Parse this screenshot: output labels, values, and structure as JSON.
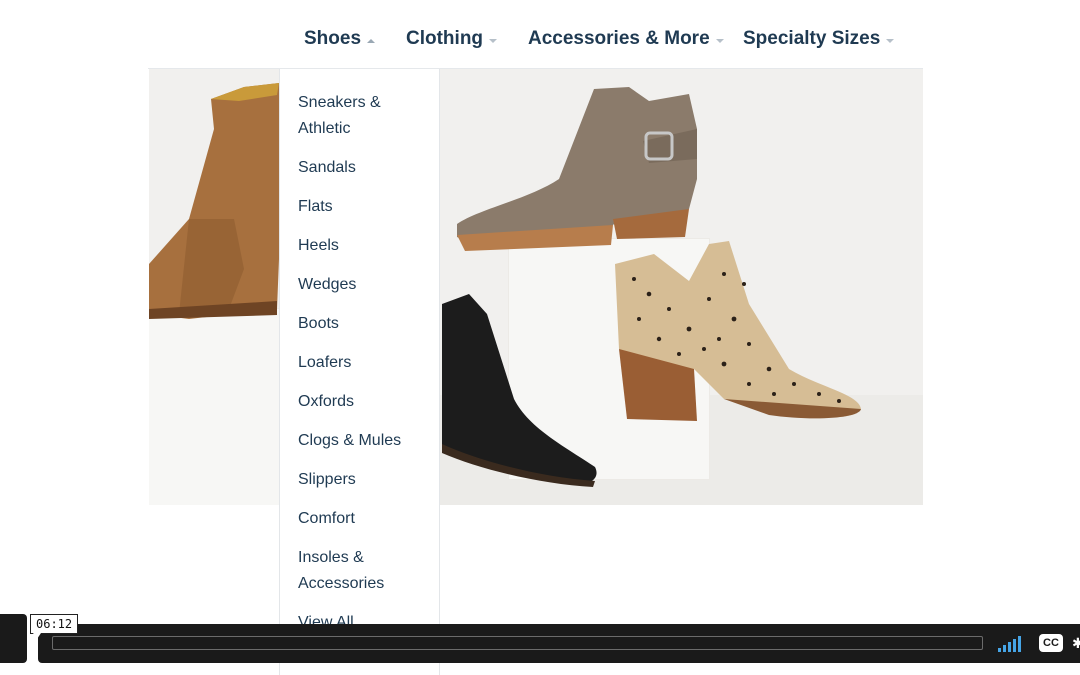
{
  "nav": {
    "items": [
      {
        "label": "Shoes",
        "active": true
      },
      {
        "label": "Clothing",
        "active": false
      },
      {
        "label": "Accessories & More",
        "active": false
      },
      {
        "label": "Specialty Sizes",
        "active": false
      }
    ]
  },
  "dropdown": {
    "items": [
      "Sneakers & Athletic",
      "Sandals",
      "Flats",
      "Heels",
      "Wedges",
      "Boots",
      "Loafers",
      "Oxfords",
      "Clogs & Mules",
      "Slippers",
      "Comfort",
      "Insoles & Accessories",
      "View All"
    ]
  },
  "hero": {
    "description_icons": [
      "tan-western-boot",
      "taupe-buckle-bootie",
      "black-pointed-boot",
      "leopard-print-bootie"
    ]
  },
  "video": {
    "timestamp": "06:12",
    "cc_label": "CC",
    "accent": "#46a5e6"
  }
}
